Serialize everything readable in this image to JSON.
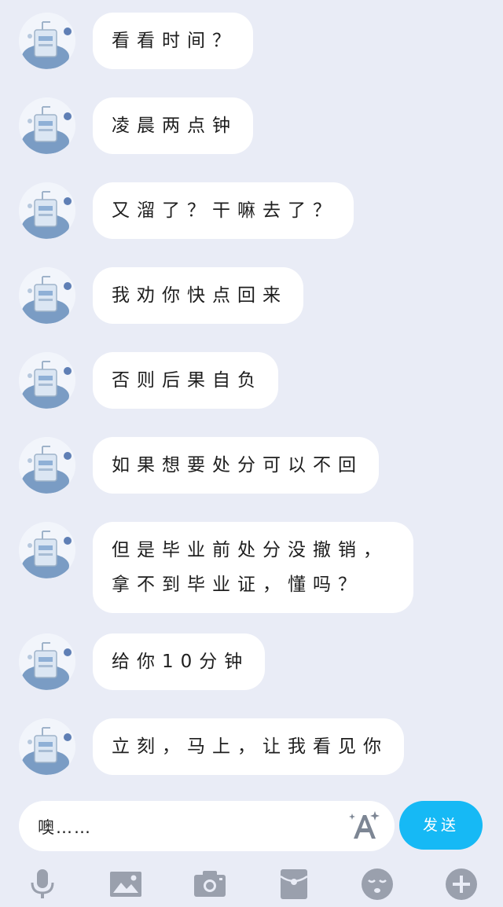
{
  "messages": [
    {
      "text": "看看时间？"
    },
    {
      "text": "凌晨两点钟"
    },
    {
      "text": "又溜了？干嘛去了？"
    },
    {
      "text": "我劝你快点回来"
    },
    {
      "text": "否则后果自负"
    },
    {
      "text": "如果想要处分可以不回"
    },
    {
      "text": "但是毕业前处分没撤销，拿不到毕业证，懂吗？"
    },
    {
      "text": "给你10分钟"
    },
    {
      "text": "立刻，马上，让我看见你"
    }
  ],
  "input": {
    "value": "噢……",
    "send_label": "发送"
  },
  "toolbar": {
    "icons": [
      "microphone-icon",
      "image-icon",
      "camera-icon",
      "red-packet-icon",
      "emoji-icon",
      "plus-icon"
    ]
  },
  "colors": {
    "background": "#e9ecf6",
    "bubble": "#ffffff",
    "send_button": "#16b9f5",
    "icon_gray": "#9aa0ad"
  }
}
